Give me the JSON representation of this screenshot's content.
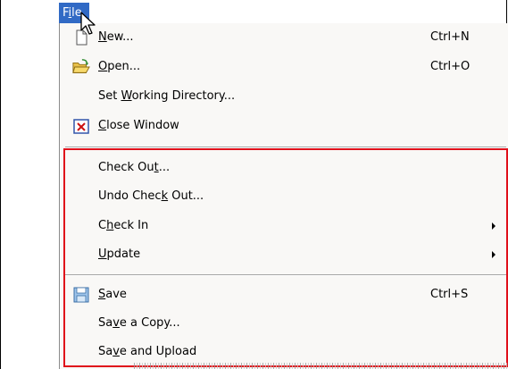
{
  "menubar": {
    "title": "File",
    "title_mnemonic_prefix": "F",
    "title_mnemonic_letter": "i",
    "title_mnemonic_suffix": "le"
  },
  "menu": {
    "items": [
      {
        "pre": "",
        "key": "N",
        "post": "ew...",
        "shortcut": "Ctrl+N",
        "icon": "new-document-icon"
      },
      {
        "pre": "",
        "key": "O",
        "post": "pen...",
        "shortcut": "Ctrl+O",
        "icon": "open-folder-icon"
      },
      {
        "pre": "Set ",
        "key": "W",
        "post": "orking Directory...",
        "shortcut": "",
        "icon": ""
      },
      {
        "pre": "",
        "key": "C",
        "post": "lose Window",
        "shortcut": "",
        "icon": "close-window-icon"
      },
      {
        "pre": "Check Ou",
        "key": "t",
        "post": "...",
        "shortcut": "",
        "icon": ""
      },
      {
        "pre": "Undo Chec",
        "key": "k",
        "post": " Out...",
        "shortcut": "",
        "icon": ""
      },
      {
        "pre": "C",
        "key": "h",
        "post": "eck In",
        "shortcut": "",
        "icon": "",
        "submenu": true
      },
      {
        "pre": "",
        "key": "U",
        "post": "pdate",
        "shortcut": "",
        "icon": "",
        "submenu": true
      },
      {
        "pre": "",
        "key": "S",
        "post": "ave",
        "shortcut": "Ctrl+S",
        "icon": "save-floppy-icon"
      },
      {
        "pre": "Sa",
        "key": "v",
        "post": "e a Copy...",
        "shortcut": "",
        "icon": ""
      },
      {
        "pre": "Sa",
        "key": "v",
        "post": "e and Upload",
        "shortcut": "",
        "icon": ""
      }
    ]
  },
  "colors": {
    "menubar_active": "#316ac5",
    "highlight_border": "#e0101a",
    "menu_background": "#f9f8f6"
  }
}
